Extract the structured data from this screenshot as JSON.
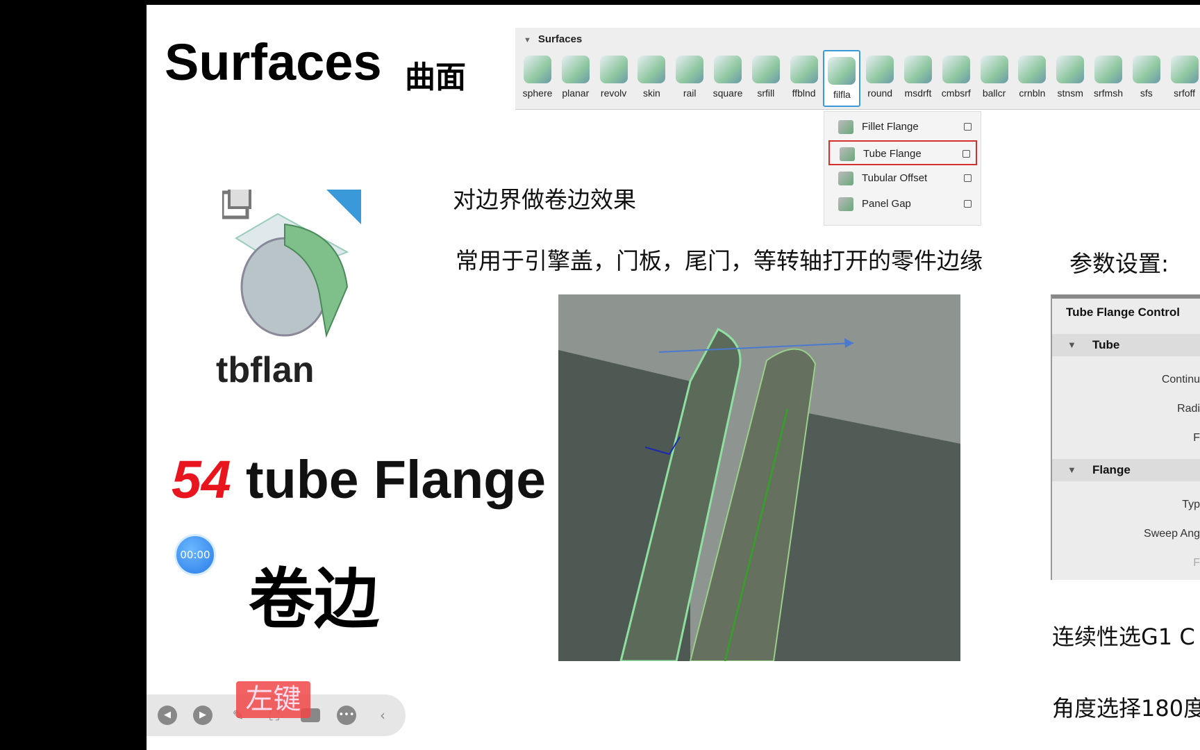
{
  "slide": {
    "title": "Surfaces",
    "title_cn": "曲面"
  },
  "toolbar": {
    "header": "Surfaces",
    "tools": [
      "sphere",
      "planar",
      "revolv",
      "skin",
      "rail",
      "square",
      "srfill",
      "ffblnd",
      "filfla",
      "round",
      "msdrft",
      "cmbsrf",
      "ballcr",
      "crnbln",
      "stnsm",
      "srfmsh",
      "sfs",
      "srfoff"
    ],
    "selected": "filfla"
  },
  "dropdown": {
    "items": [
      "Fillet Flange",
      "Tube Flange",
      "Tubular Offset",
      "Panel Gap"
    ],
    "highlighted": "Tube Flange"
  },
  "icon_label": "tbflan",
  "desc1": "对边界做卷边效果",
  "desc2": "常用于引擎盖，门板，尾门，等转轴打开的零件边缘",
  "param_title": "参数设置:",
  "main_title": {
    "number": "54",
    "text": " tube Flange"
  },
  "timer": "00:00",
  "subtitle": "卷边",
  "panel": {
    "title": "Tube Flange Control",
    "sections": [
      {
        "name": "Tube",
        "fields": [
          "Continu",
          "Radi",
          "F"
        ]
      },
      {
        "name": "Flange",
        "fields": [
          "Typ",
          "Sweep Ang",
          "F"
        ]
      }
    ]
  },
  "notes": [
    "连续性选G1 C",
    "角度选择180度"
  ],
  "overlay_key": "左键",
  "colors": {
    "accent_red": "#e8141e",
    "highlight_border": "#d32f2f",
    "selected_tool": "#3a9ad9"
  }
}
